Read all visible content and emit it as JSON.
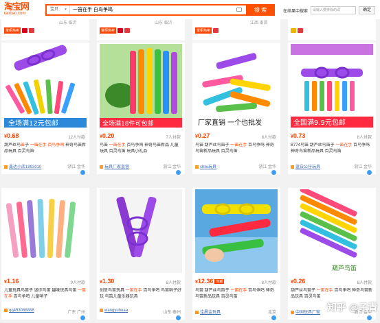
{
  "header": {
    "logo_cn": "淘宝网",
    "logo_en": "taobao.com",
    "category_label": "宝贝",
    "search_query": "一笛在手 白鸟争鸣",
    "search_button": "搜 索",
    "within_label": "在结果中搜索",
    "within_placeholder": "请输入要排除的词",
    "within_button": "确定"
  },
  "prev_row": [
    {
      "line": "山东 临沂",
      "shop_loc": "山东 临沂",
      "brand_tag": "掌柜热卖"
    },
    {
      "line": "山东 临沂",
      "shop_loc": "",
      "brand_tag": "掌柜热卖"
    },
    {
      "line": "江西 南昌",
      "shop_loc": "",
      "brand_tag": "掌柜热卖"
    },
    {
      "line": "",
      "shop_loc": "",
      "brand_tag": ""
    }
  ],
  "products": [
    {
      "price": "0.68",
      "sold": "12人付款",
      "badge": "",
      "title_pre": "葫芦丝鸟",
      "title_hl1": "笛",
      "title_mid": "子 ",
      "title_hl2": "一笛在手 百鸟争鸣",
      "title_post": " 神奇鸟笛新品玩具 百灵鸟笛",
      "shop": "鑫达小店1993010",
      "loc": "浙江 金华",
      "banner": "全场满12元包邮"
    },
    {
      "price": "0.20",
      "sold": "7人付款",
      "badge": "",
      "title_pre": "鸟笛 ",
      "title_hl1": "一笛在手",
      "title_mid": " 百鸟争鸣 神奇鸟笛新品 儿童玩具 百灵鸟笛 ",
      "title_hl2": "",
      "title_post": "玩具小礼品",
      "shop": "玩具厂家直营",
      "loc": "浙江 金华",
      "banner": "全场满18件可包邮"
    },
    {
      "price": "0.27",
      "sold": "8人付款",
      "badge": "",
      "title_pre": "鸟笛 葫芦丝鸟笛子 ",
      "title_hl1": "一笛在手",
      "title_mid": " 百鸟争鸣 神奇鸟笛新品玩具 百灵鸟笛",
      "title_hl2": "",
      "title_post": "",
      "shop": "chlxi玩具",
      "loc": "浙江 金华",
      "banner": "厂家直销 一个也批发"
    },
    {
      "price": "0.73",
      "sold": "8人付款",
      "badge": "",
      "title_pre": "B774鸟笛 葫芦丝鸟笛子 ",
      "title_hl1": "一笛在手",
      "title_mid": " 百鸟争鸣 神奇鸟笛新品玩具 百灵鸟笛",
      "title_hl2": "",
      "title_post": "",
      "shop": "蓝白公仔玩具",
      "loc": "浙江 金华",
      "banner": "全国满9.9元包邮"
    },
    {
      "price": "1.16",
      "sold": "9人付款",
      "badge": "",
      "title_pre": "儿童玩具鸟笛子 迷你鸟笛 趣味玩具鸟笛 ",
      "title_hl1": "一笛在手",
      "title_mid": " 百鸟争鸣 儿童哨子",
      "title_hl2": "",
      "title_post": "",
      "shop": "qq453088888",
      "loc": "广东 广州",
      "banner": ""
    },
    {
      "price": "1.30",
      "sold": "8人付款",
      "badge": "",
      "title_pre": "创意鸟笛玩具 ",
      "title_hl1": "一笛在手",
      "title_mid": " 百鸟争鸣 鸟笛哨子好玩 鸟笛儿童乐器玩具",
      "title_hl2": "",
      "title_post": "",
      "shop": "wangyuhuaa",
      "loc": "山东 泰州",
      "banner": ""
    },
    {
      "price": "12.36",
      "sold": "8人付款",
      "badge": "包邮",
      "title_pre": "鸟笛 葫芦丝鸟笛子 ",
      "title_hl1": "一笛在手",
      "title_mid": " 百鸟争鸣 神奇鸟笛新品玩具 百灵鸟笛",
      "title_hl2": "",
      "title_post": "",
      "shop": "佳晨金玩具",
      "loc": "北京",
      "banner": ""
    },
    {
      "price": "0.26",
      "sold": "8人付款",
      "badge": "",
      "title_pre": "葫芦丝鸟笛子 ",
      "title_hl1": "一笛在手",
      "title_mid": " 百鸟争鸣 神奇鸟笛新品玩具 百灵鸟笛",
      "title_hl2": "",
      "title_post": "",
      "shop": "中国玩具厂家",
      "loc": "浙江 金华",
      "banner": "葫芦鸟笛"
    }
  ],
  "watermark": "知乎 @子青",
  "colors": {
    "accent": "#ff5000",
    "price": "#ff4400",
    "link": "#3d6ab0"
  }
}
